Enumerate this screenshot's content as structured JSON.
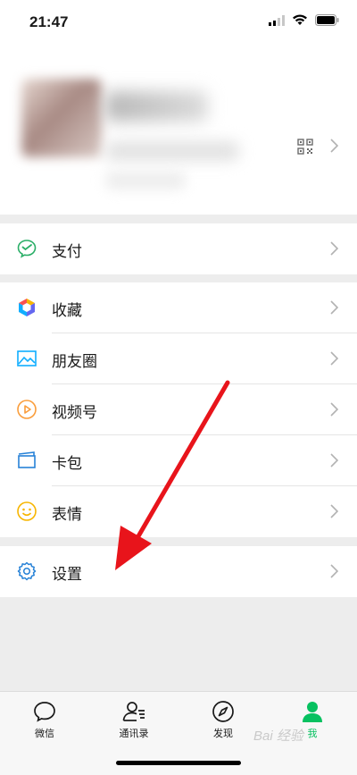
{
  "status_bar": {
    "time": "21:47"
  },
  "menu": [
    {
      "label": "支付",
      "icon": "pay-icon"
    },
    {
      "label": "收藏",
      "icon": "favorites-icon"
    },
    {
      "label": "朋友圈",
      "icon": "moments-icon"
    },
    {
      "label": "视频号",
      "icon": "channels-icon"
    },
    {
      "label": "卡包",
      "icon": "card-wallet-icon"
    },
    {
      "label": "表情",
      "icon": "sticker-icon"
    },
    {
      "label": "设置",
      "icon": "settings-icon"
    }
  ],
  "tabs": [
    {
      "label": "微信",
      "icon": "chat-icon"
    },
    {
      "label": "通讯录",
      "icon": "contacts-icon"
    },
    {
      "label": "发现",
      "icon": "discover-icon"
    },
    {
      "label": "我",
      "icon": "me-icon",
      "active": true
    }
  ],
  "colors": {
    "accent": "#07c160",
    "annotation_arrow": "#e8141b"
  },
  "watermark": "Bai 经验"
}
